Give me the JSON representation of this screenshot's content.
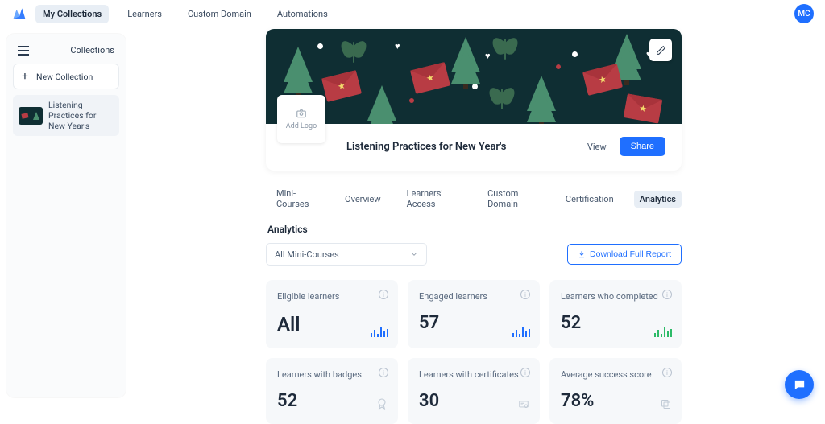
{
  "nav": {
    "tabs": [
      "My Collections",
      "Learners",
      "Custom Domain",
      "Automations"
    ],
    "avatar_initials": "MC"
  },
  "sidebar": {
    "title": "Collections",
    "new_label": "New Collection",
    "items": [
      {
        "label": "Listening Practices for New Year's"
      }
    ]
  },
  "banner": {
    "add_logo": "Add Logo",
    "title": "Listening Practices for New Year's",
    "view": "View",
    "share": "Share"
  },
  "course_tabs": [
    "Mini-Courses",
    "Overview",
    "Learners' Access",
    "Custom Domain",
    "Certification",
    "Analytics"
  ],
  "analytics": {
    "heading": "Analytics",
    "filter_label": "All Mini-Courses",
    "download_label": "Download Full Report",
    "cards": [
      {
        "label": "Eligible learners",
        "value": "All",
        "icon": "spark-blue"
      },
      {
        "label": "Engaged learners",
        "value": "57",
        "icon": "spark-blue"
      },
      {
        "label": "Learners who completed",
        "value": "52",
        "icon": "spark-green"
      },
      {
        "label": "Learners with badges",
        "value": "52",
        "icon": "badge"
      },
      {
        "label": "Learners with certificates",
        "value": "30",
        "icon": "certificate"
      },
      {
        "label": "Average success score",
        "value": "78%",
        "icon": "copy"
      }
    ]
  },
  "colors": {
    "accent": "#1f6fff",
    "green": "#2dbb68"
  }
}
